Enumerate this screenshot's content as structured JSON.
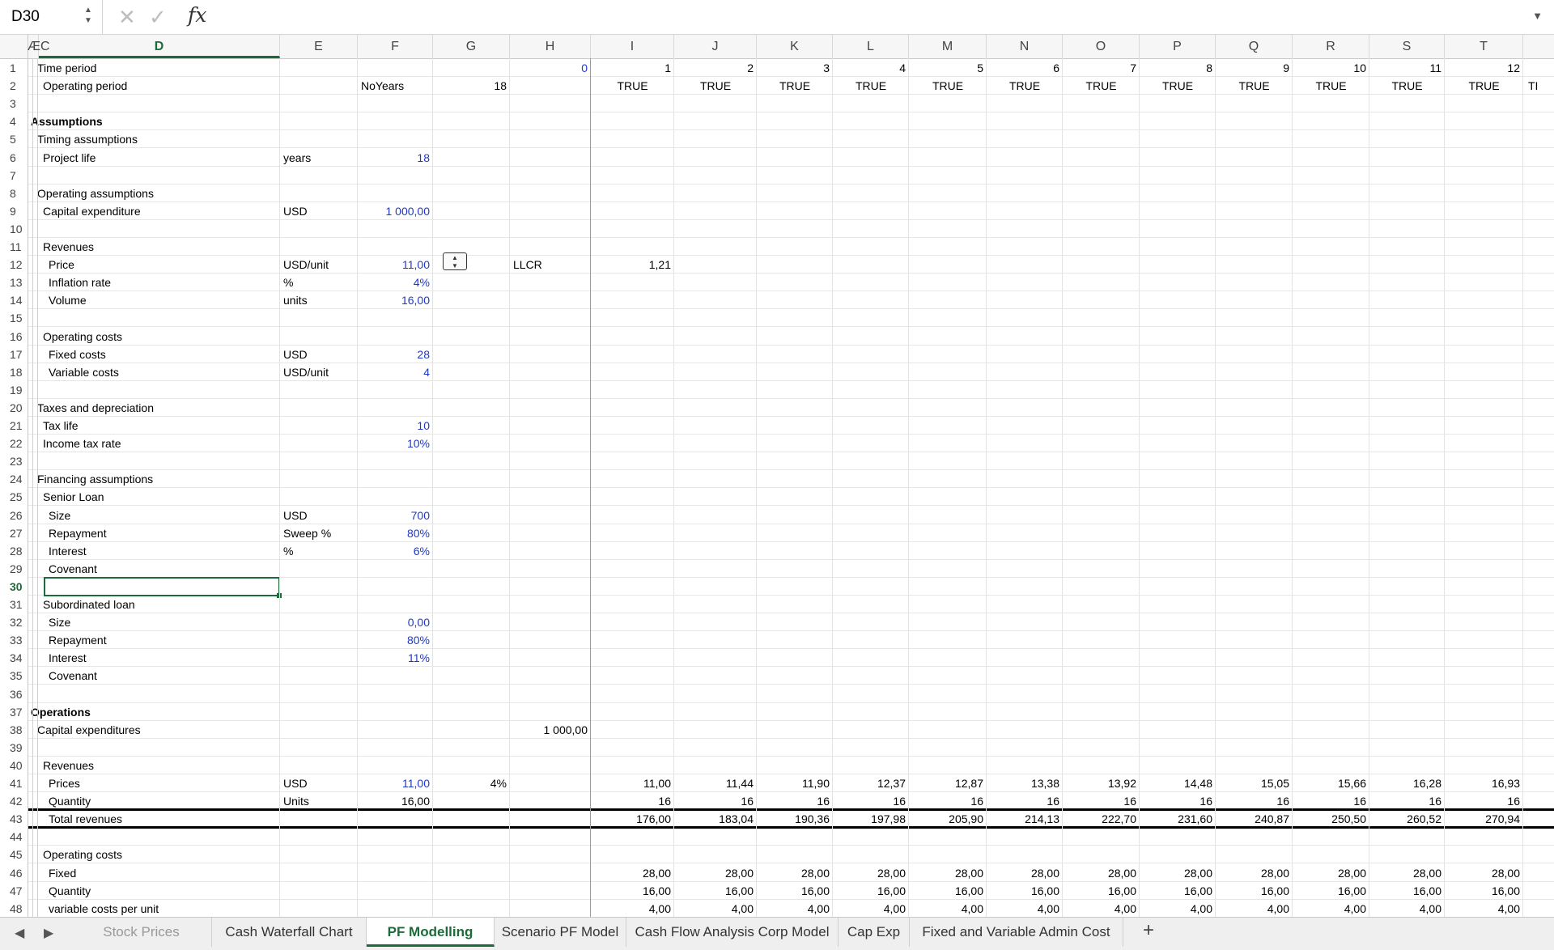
{
  "formula_bar": {
    "name_box": "D30",
    "cancel_icon": "✕",
    "confirm_icon": "✓",
    "fx_label": "fx",
    "formula": "",
    "expand_icon": "▼"
  },
  "columns": [
    "ÆC",
    "D",
    "E",
    "F",
    "G",
    "H",
    "I",
    "J",
    "K",
    "L",
    "M",
    "N",
    "O",
    "P",
    "Q",
    "R",
    "S",
    "T"
  ],
  "selected_column": "D",
  "selected_row": 30,
  "row_numbers": [
    1,
    2,
    3,
    4,
    5,
    6,
    7,
    8,
    9,
    10,
    11,
    12,
    13,
    14,
    15,
    16,
    17,
    18,
    19,
    20,
    21,
    22,
    23,
    24,
    25,
    26,
    27,
    28,
    29,
    30,
    31,
    32,
    33,
    34,
    35,
    36,
    37,
    38,
    39,
    40,
    41,
    42,
    43,
    44,
    45,
    46,
    47,
    48
  ],
  "rows": [
    {
      "n": 1,
      "cells": [
        {
          "c": "C",
          "v": "Time period"
        },
        {
          "c": "H",
          "v": "0",
          "blue": true,
          "r": true
        },
        {
          "c": "I",
          "v": "1",
          "r": true
        },
        {
          "c": "J",
          "v": "2",
          "r": true
        },
        {
          "c": "K",
          "v": "3",
          "r": true
        },
        {
          "c": "L",
          "v": "4",
          "r": true
        },
        {
          "c": "M",
          "v": "5",
          "r": true
        },
        {
          "c": "N",
          "v": "6",
          "r": true
        },
        {
          "c": "O",
          "v": "7",
          "r": true
        },
        {
          "c": "P",
          "v": "8",
          "r": true
        },
        {
          "c": "Q",
          "v": "9",
          "r": true
        },
        {
          "c": "R",
          "v": "10",
          "r": true
        },
        {
          "c": "S",
          "v": "11",
          "r": true
        },
        {
          "c": "T",
          "v": "12",
          "r": true
        }
      ]
    },
    {
      "n": 2,
      "cells": [
        {
          "c": "D",
          "v": "Operating period"
        },
        {
          "c": "F",
          "v": "NoYears"
        },
        {
          "c": "G",
          "v": "18",
          "r": true
        },
        {
          "c": "I",
          "v": "TRUE",
          "ctr": true
        },
        {
          "c": "J",
          "v": "TRUE",
          "ctr": true
        },
        {
          "c": "K",
          "v": "TRUE",
          "ctr": true
        },
        {
          "c": "L",
          "v": "TRUE",
          "ctr": true
        },
        {
          "c": "M",
          "v": "TRUE",
          "ctr": true
        },
        {
          "c": "N",
          "v": "TRUE",
          "ctr": true
        },
        {
          "c": "O",
          "v": "TRUE",
          "ctr": true
        },
        {
          "c": "P",
          "v": "TRUE",
          "ctr": true
        },
        {
          "c": "Q",
          "v": "TRUE",
          "ctr": true
        },
        {
          "c": "R",
          "v": "TRUE",
          "ctr": true
        },
        {
          "c": "S",
          "v": "TRUE",
          "ctr": true
        },
        {
          "c": "T",
          "v": "TRUE",
          "ctr": true
        },
        {
          "c": "U",
          "v": "TI"
        }
      ]
    },
    {
      "n": 3,
      "cells": []
    },
    {
      "n": 4,
      "cells": [
        {
          "c": "B",
          "v": "Assumptions",
          "b": true
        }
      ]
    },
    {
      "n": 5,
      "cells": [
        {
          "c": "C",
          "v": "Timing assumptions"
        }
      ]
    },
    {
      "n": 6,
      "cells": [
        {
          "c": "D",
          "v": "Project life"
        },
        {
          "c": "E",
          "v": "years"
        },
        {
          "c": "F",
          "v": "18",
          "blue": true,
          "r": true
        }
      ]
    },
    {
      "n": 7,
      "cells": []
    },
    {
      "n": 8,
      "cells": [
        {
          "c": "C",
          "v": "Operating assumptions"
        }
      ]
    },
    {
      "n": 9,
      "cells": [
        {
          "c": "D",
          "v": "Capital expenditure"
        },
        {
          "c": "E",
          "v": "USD"
        },
        {
          "c": "F",
          "v": "1 000,00",
          "blue": true,
          "r": true
        }
      ]
    },
    {
      "n": 10,
      "cells": []
    },
    {
      "n": 11,
      "cells": [
        {
          "c": "D",
          "v": "Revenues"
        }
      ]
    },
    {
      "n": 12,
      "cells": [
        {
          "c": "D2",
          "v": "Price"
        },
        {
          "c": "E",
          "v": "USD/unit"
        },
        {
          "c": "F",
          "v": "11,00",
          "blue": true,
          "r": true
        },
        {
          "c": "H",
          "v": "LLCR"
        },
        {
          "c": "I",
          "v": "1,21",
          "r": true
        }
      ]
    },
    {
      "n": 13,
      "cells": [
        {
          "c": "D2",
          "v": "Inflation rate"
        },
        {
          "c": "E",
          "v": "%"
        },
        {
          "c": "F",
          "v": "4%",
          "blue": true,
          "r": true
        }
      ]
    },
    {
      "n": 14,
      "cells": [
        {
          "c": "D2",
          "v": "Volume"
        },
        {
          "c": "E",
          "v": "units"
        },
        {
          "c": "F",
          "v": "16,00",
          "blue": true,
          "r": true
        }
      ]
    },
    {
      "n": 15,
      "cells": []
    },
    {
      "n": 16,
      "cells": [
        {
          "c": "D",
          "v": "Operating costs"
        }
      ]
    },
    {
      "n": 17,
      "cells": [
        {
          "c": "D2",
          "v": "Fixed costs"
        },
        {
          "c": "E",
          "v": "USD"
        },
        {
          "c": "F",
          "v": "28",
          "blue": true,
          "r": true
        }
      ]
    },
    {
      "n": 18,
      "cells": [
        {
          "c": "D2",
          "v": "Variable costs"
        },
        {
          "c": "E",
          "v": "USD/unit"
        },
        {
          "c": "F",
          "v": "4",
          "blue": true,
          "r": true
        }
      ]
    },
    {
      "n": 19,
      "cells": []
    },
    {
      "n": 20,
      "cells": [
        {
          "c": "C",
          "v": "Taxes and depreciation"
        }
      ]
    },
    {
      "n": 21,
      "cells": [
        {
          "c": "D",
          "v": "Tax life"
        },
        {
          "c": "F",
          "v": "10",
          "blue": true,
          "r": true
        }
      ]
    },
    {
      "n": 22,
      "cells": [
        {
          "c": "D",
          "v": "Income tax rate"
        },
        {
          "c": "F",
          "v": "10%",
          "blue": true,
          "r": true
        }
      ]
    },
    {
      "n": 23,
      "cells": []
    },
    {
      "n": 24,
      "cells": [
        {
          "c": "C",
          "v": "Financing assumptions"
        }
      ]
    },
    {
      "n": 25,
      "cells": [
        {
          "c": "D",
          "v": "Senior Loan"
        }
      ]
    },
    {
      "n": 26,
      "cells": [
        {
          "c": "D2",
          "v": "Size"
        },
        {
          "c": "E",
          "v": "USD"
        },
        {
          "c": "F",
          "v": "700",
          "blue": true,
          "r": true
        }
      ]
    },
    {
      "n": 27,
      "cells": [
        {
          "c": "D2",
          "v": "Repayment"
        },
        {
          "c": "E",
          "v": "Sweep %"
        },
        {
          "c": "F",
          "v": "80%",
          "blue": true,
          "r": true
        }
      ]
    },
    {
      "n": 28,
      "cells": [
        {
          "c": "D2",
          "v": "Interest"
        },
        {
          "c": "E",
          "v": "%"
        },
        {
          "c": "F",
          "v": "6%",
          "blue": true,
          "r": true
        }
      ]
    },
    {
      "n": 29,
      "cells": [
        {
          "c": "D2",
          "v": "Covenant"
        }
      ]
    },
    {
      "n": 30,
      "cells": []
    },
    {
      "n": 31,
      "cells": [
        {
          "c": "D",
          "v": "Subordinated loan"
        }
      ]
    },
    {
      "n": 32,
      "cells": [
        {
          "c": "D2",
          "v": "Size"
        },
        {
          "c": "F",
          "v": "0,00",
          "blue": true,
          "r": true
        }
      ]
    },
    {
      "n": 33,
      "cells": [
        {
          "c": "D2",
          "v": "Repayment"
        },
        {
          "c": "F",
          "v": "80%",
          "blue": true,
          "r": true
        }
      ]
    },
    {
      "n": 34,
      "cells": [
        {
          "c": "D2",
          "v": "Interest"
        },
        {
          "c": "F",
          "v": "11%",
          "blue": true,
          "r": true
        }
      ]
    },
    {
      "n": 35,
      "cells": [
        {
          "c": "D2",
          "v": "Covenant"
        }
      ]
    },
    {
      "n": 36,
      "cells": []
    },
    {
      "n": 37,
      "cells": [
        {
          "c": "B",
          "v": "Operations",
          "b": true
        }
      ]
    },
    {
      "n": 38,
      "cells": [
        {
          "c": "C",
          "v": "Capital expenditures"
        },
        {
          "c": "H",
          "v": "1 000,00",
          "r": true
        }
      ]
    },
    {
      "n": 39,
      "cells": []
    },
    {
      "n": 40,
      "cells": [
        {
          "c": "D",
          "v": "Revenues"
        }
      ]
    },
    {
      "n": 41,
      "cells": [
        {
          "c": "D2",
          "v": "Prices"
        },
        {
          "c": "E",
          "v": "USD"
        },
        {
          "c": "F",
          "v": "11,00",
          "blue": true,
          "r": true
        },
        {
          "c": "G",
          "v": "4%",
          "r": true
        },
        {
          "c": "I",
          "v": "11,00",
          "r": true
        },
        {
          "c": "J",
          "v": "11,44",
          "r": true
        },
        {
          "c": "K",
          "v": "11,90",
          "r": true
        },
        {
          "c": "L",
          "v": "12,37",
          "r": true
        },
        {
          "c": "M",
          "v": "12,87",
          "r": true
        },
        {
          "c": "N",
          "v": "13,38",
          "r": true
        },
        {
          "c": "O",
          "v": "13,92",
          "r": true
        },
        {
          "c": "P",
          "v": "14,48",
          "r": true
        },
        {
          "c": "Q",
          "v": "15,05",
          "r": true
        },
        {
          "c": "R",
          "v": "15,66",
          "r": true
        },
        {
          "c": "S",
          "v": "16,28",
          "r": true
        },
        {
          "c": "T",
          "v": "16,93",
          "r": true
        }
      ]
    },
    {
      "n": 42,
      "cells": [
        {
          "c": "D2",
          "v": "Quantity"
        },
        {
          "c": "E",
          "v": "Units"
        },
        {
          "c": "F",
          "v": "16,00",
          "r": true
        },
        {
          "c": "I",
          "v": "16",
          "r": true
        },
        {
          "c": "J",
          "v": "16",
          "r": true
        },
        {
          "c": "K",
          "v": "16",
          "r": true
        },
        {
          "c": "L",
          "v": "16",
          "r": true
        },
        {
          "c": "M",
          "v": "16",
          "r": true
        },
        {
          "c": "N",
          "v": "16",
          "r": true
        },
        {
          "c": "O",
          "v": "16",
          "r": true
        },
        {
          "c": "P",
          "v": "16",
          "r": true
        },
        {
          "c": "Q",
          "v": "16",
          "r": true
        },
        {
          "c": "R",
          "v": "16",
          "r": true
        },
        {
          "c": "S",
          "v": "16",
          "r": true
        },
        {
          "c": "T",
          "v": "16",
          "r": true
        }
      ],
      "thick_bottom": true
    },
    {
      "n": 43,
      "cells": [
        {
          "c": "D2",
          "v": "Total revenues"
        },
        {
          "c": "I",
          "v": "176,00",
          "r": true
        },
        {
          "c": "J",
          "v": "183,04",
          "r": true
        },
        {
          "c": "K",
          "v": "190,36",
          "r": true
        },
        {
          "c": "L",
          "v": "197,98",
          "r": true
        },
        {
          "c": "M",
          "v": "205,90",
          "r": true
        },
        {
          "c": "N",
          "v": "214,13",
          "r": true
        },
        {
          "c": "O",
          "v": "222,70",
          "r": true
        },
        {
          "c": "P",
          "v": "231,60",
          "r": true
        },
        {
          "c": "Q",
          "v": "240,87",
          "r": true
        },
        {
          "c": "R",
          "v": "250,50",
          "r": true
        },
        {
          "c": "S",
          "v": "260,52",
          "r": true
        },
        {
          "c": "T",
          "v": "270,94",
          "r": true
        }
      ],
      "thick_bottom": true
    },
    {
      "n": 44,
      "cells": []
    },
    {
      "n": 45,
      "cells": [
        {
          "c": "D",
          "v": "Operating costs"
        }
      ]
    },
    {
      "n": 46,
      "cells": [
        {
          "c": "D2",
          "v": "Fixed"
        },
        {
          "c": "I",
          "v": "28,00",
          "r": true
        },
        {
          "c": "J",
          "v": "28,00",
          "r": true
        },
        {
          "c": "K",
          "v": "28,00",
          "r": true
        },
        {
          "c": "L",
          "v": "28,00",
          "r": true
        },
        {
          "c": "M",
          "v": "28,00",
          "r": true
        },
        {
          "c": "N",
          "v": "28,00",
          "r": true
        },
        {
          "c": "O",
          "v": "28,00",
          "r": true
        },
        {
          "c": "P",
          "v": "28,00",
          "r": true
        },
        {
          "c": "Q",
          "v": "28,00",
          "r": true
        },
        {
          "c": "R",
          "v": "28,00",
          "r": true
        },
        {
          "c": "S",
          "v": "28,00",
          "r": true
        },
        {
          "c": "T",
          "v": "28,00",
          "r": true
        }
      ]
    },
    {
      "n": 47,
      "cells": [
        {
          "c": "D2",
          "v": "Quantity"
        },
        {
          "c": "I",
          "v": "16,00",
          "r": true
        },
        {
          "c": "J",
          "v": "16,00",
          "r": true
        },
        {
          "c": "K",
          "v": "16,00",
          "r": true
        },
        {
          "c": "L",
          "v": "16,00",
          "r": true
        },
        {
          "c": "M",
          "v": "16,00",
          "r": true
        },
        {
          "c": "N",
          "v": "16,00",
          "r": true
        },
        {
          "c": "O",
          "v": "16,00",
          "r": true
        },
        {
          "c": "P",
          "v": "16,00",
          "r": true
        },
        {
          "c": "Q",
          "v": "16,00",
          "r": true
        },
        {
          "c": "R",
          "v": "16,00",
          "r": true
        },
        {
          "c": "S",
          "v": "16,00",
          "r": true
        },
        {
          "c": "T",
          "v": "16,00",
          "r": true
        }
      ]
    },
    {
      "n": 48,
      "cells": [
        {
          "c": "D2",
          "v": "variable costs per unit"
        },
        {
          "c": "I",
          "v": "4,00",
          "r": true
        },
        {
          "c": "J",
          "v": "4,00",
          "r": true
        },
        {
          "c": "K",
          "v": "4,00",
          "r": true
        },
        {
          "c": "L",
          "v": "4,00",
          "r": true
        },
        {
          "c": "M",
          "v": "4,00",
          "r": true
        },
        {
          "c": "N",
          "v": "4,00",
          "r": true
        },
        {
          "c": "O",
          "v": "4,00",
          "r": true
        },
        {
          "c": "P",
          "v": "4,00",
          "r": true
        },
        {
          "c": "Q",
          "v": "4,00",
          "r": true
        },
        {
          "c": "R",
          "v": "4,00",
          "r": true
        },
        {
          "c": "S",
          "v": "4,00",
          "r": true
        },
        {
          "c": "T",
          "v": "4,00",
          "r": true
        }
      ]
    }
  ],
  "sheet_tabs": {
    "prev_icon": "◀",
    "next_icon": "▶",
    "tabs": [
      {
        "label": "Stock Prices",
        "active": false,
        "faded": true
      },
      {
        "label": "Cash Waterfall Chart",
        "active": false
      },
      {
        "label": "PF Modelling",
        "active": true
      },
      {
        "label": "Scenario PF Model",
        "active": false
      },
      {
        "label": "Cash Flow Analysis Corp Model",
        "active": false
      },
      {
        "label": "Cap Exp",
        "active": false
      },
      {
        "label": "Fixed and Variable Admin Cost",
        "active": false
      }
    ],
    "add_icon": "+"
  },
  "colors": {
    "accent": "#1d6b3a",
    "input_blue": "#2038c9"
  }
}
